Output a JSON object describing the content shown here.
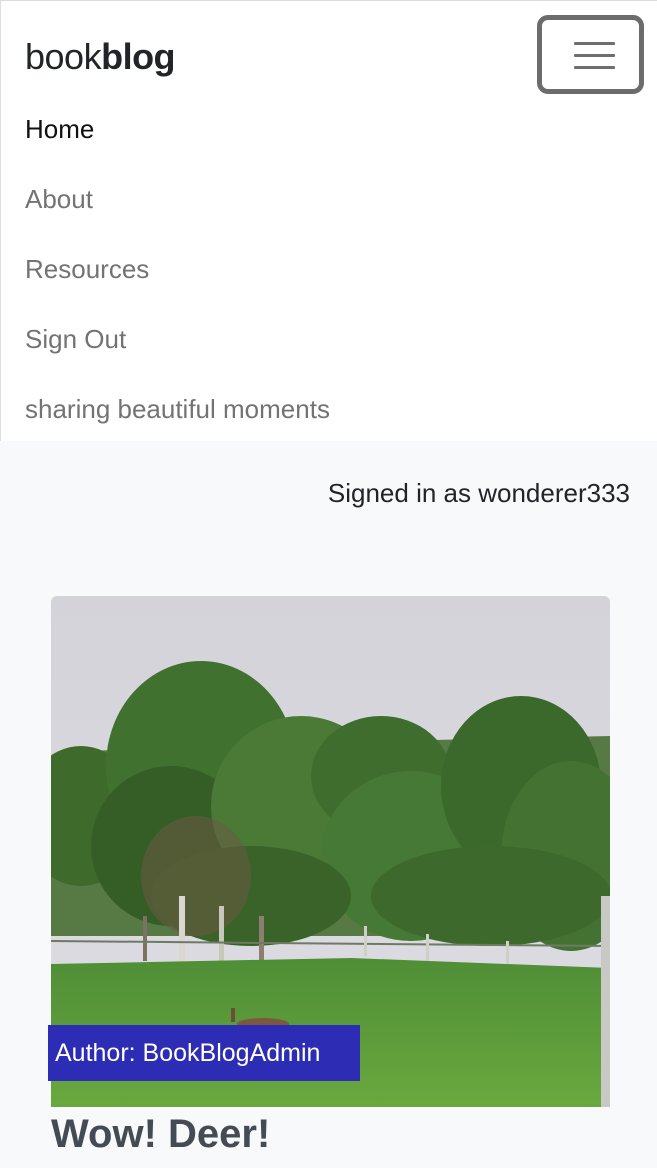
{
  "navbar": {
    "brand_light": "book",
    "brand_bold": "blog",
    "links": [
      {
        "label": "Home",
        "active": true
      },
      {
        "label": "About",
        "active": false
      },
      {
        "label": "Resources",
        "active": false
      },
      {
        "label": "Sign Out",
        "active": false
      }
    ],
    "tagline": "sharing beautiful moments"
  },
  "user": {
    "signed_in_text": "Signed in as wonderer333"
  },
  "post": {
    "author_label": "Author: BookBlogAdmin",
    "title": "Wow! Deer!"
  },
  "colors": {
    "page_background": "#f8f9fa",
    "navbar_background": "#ffffff",
    "author_badge": "#2c2cb4",
    "title_text": "#454b55",
    "muted_link": "#737373"
  }
}
